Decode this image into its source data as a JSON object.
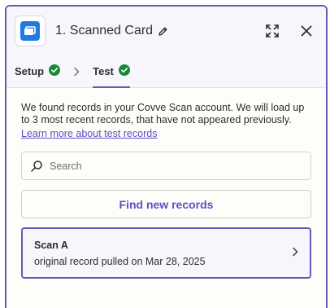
{
  "header": {
    "title": "1. Scanned Card",
    "app_icon": "covve-scan-icon",
    "edit_icon": "pencil-icon",
    "expand_icon": "expand-icon",
    "close_icon": "close-icon"
  },
  "tabs": [
    {
      "label": "Setup",
      "status_icon": "check-circle-icon",
      "active": false
    },
    {
      "label": "Test",
      "status_icon": "check-circle-icon",
      "active": true
    }
  ],
  "test": {
    "description": "We found records in your Covve Scan account. We will load up to 3 most recent records, that have not appeared previously.",
    "learn_more_link": "Learn more about test records",
    "search_placeholder": "Search",
    "search_value": "",
    "find_button": "Find new records",
    "records": [
      {
        "title": "Scan A",
        "subtitle": "original record pulled on Mar 28, 2025"
      }
    ]
  },
  "colors": {
    "accent": "#6559b3",
    "link": "#5b4fc7",
    "success": "#188a33",
    "app_blue": "#1f7be0"
  }
}
